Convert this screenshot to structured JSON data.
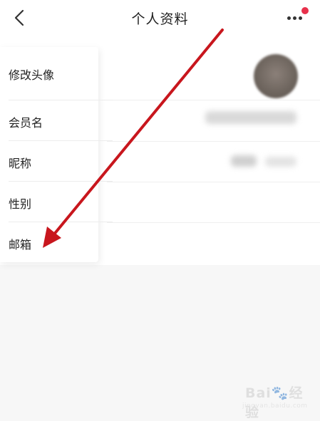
{
  "header": {
    "title": "个人资料",
    "back_icon": "chevron-left-icon",
    "more_icon": "more-horizontal-icon",
    "badge_color": "#e8304b"
  },
  "menu": {
    "items": [
      {
        "label": "修改头像"
      },
      {
        "label": "会员名"
      },
      {
        "label": "昵称"
      },
      {
        "label": "性别"
      },
      {
        "label": "邮箱"
      }
    ]
  },
  "annotation": {
    "arrow_color": "#c8161d"
  },
  "watermark": {
    "brand": "Bai",
    "brand_suffix": "经验",
    "site": "jingyan.baidu.com"
  }
}
